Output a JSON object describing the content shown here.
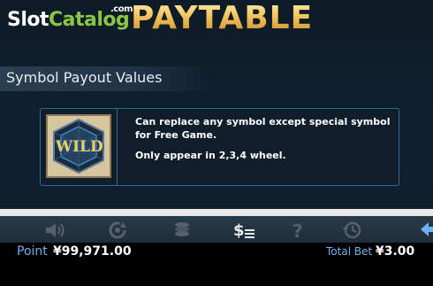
{
  "logo": {
    "slot": "Slot",
    "catalog": "Catalog",
    "com": ".com"
  },
  "header": {
    "title": "PAYTABLE"
  },
  "section": {
    "title": "Symbol Payout Values"
  },
  "wild_symbol": {
    "label": "WILD",
    "description": "Can replace any symbol except special symbol for Free Game.",
    "note": "Only appear in 2,3,4 wheel."
  },
  "toolbar": {
    "icons": [
      "speaker-icon",
      "autoplay-icon",
      "coins-icon",
      "paytable-icon",
      "help-icon",
      "history-icon",
      "back-arrow-icon"
    ]
  },
  "status": {
    "point_label": "Point",
    "point_value": "¥99,971.00",
    "total_bet_label": "Total Bet",
    "total_bet_value": "¥3.00"
  },
  "colors": {
    "gold": "#f3c463",
    "accent_blue": "#6fb0ee",
    "panel_border": "#2f6a9a"
  }
}
